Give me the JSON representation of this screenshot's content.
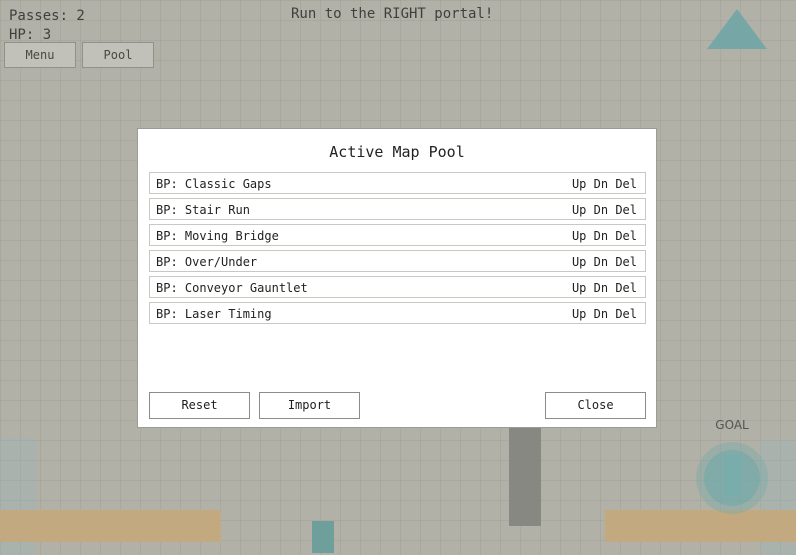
{
  "hud": {
    "passes": "Passes: 2",
    "hp": "HP: 3",
    "menu_label": "Menu",
    "pool_label": "Pool",
    "objective": "Run to the RIGHT portal!"
  },
  "goal_label": "GOAL",
  "dialog": {
    "title": "Active Map Pool",
    "items": [
      {
        "name": "BP: Classic Gaps"
      },
      {
        "name": "BP: Stair Run"
      },
      {
        "name": "BP: Moving Bridge"
      },
      {
        "name": "BP: Over/Under"
      },
      {
        "name": "BP: Conveyor Gauntlet"
      },
      {
        "name": "BP: Laser Timing"
      }
    ],
    "controls": {
      "up": "Up",
      "down": "Dn",
      "delete": "Del"
    },
    "reset_label": "Reset",
    "import_label": "Import",
    "close_label": "Close"
  },
  "colors": {
    "background": "#b8b7ae",
    "platform": "#cfac79",
    "pillar": "#7f807a",
    "player": "#5e9f9c",
    "portal": "#5dabaf",
    "triangle": "#6aa8ab"
  }
}
